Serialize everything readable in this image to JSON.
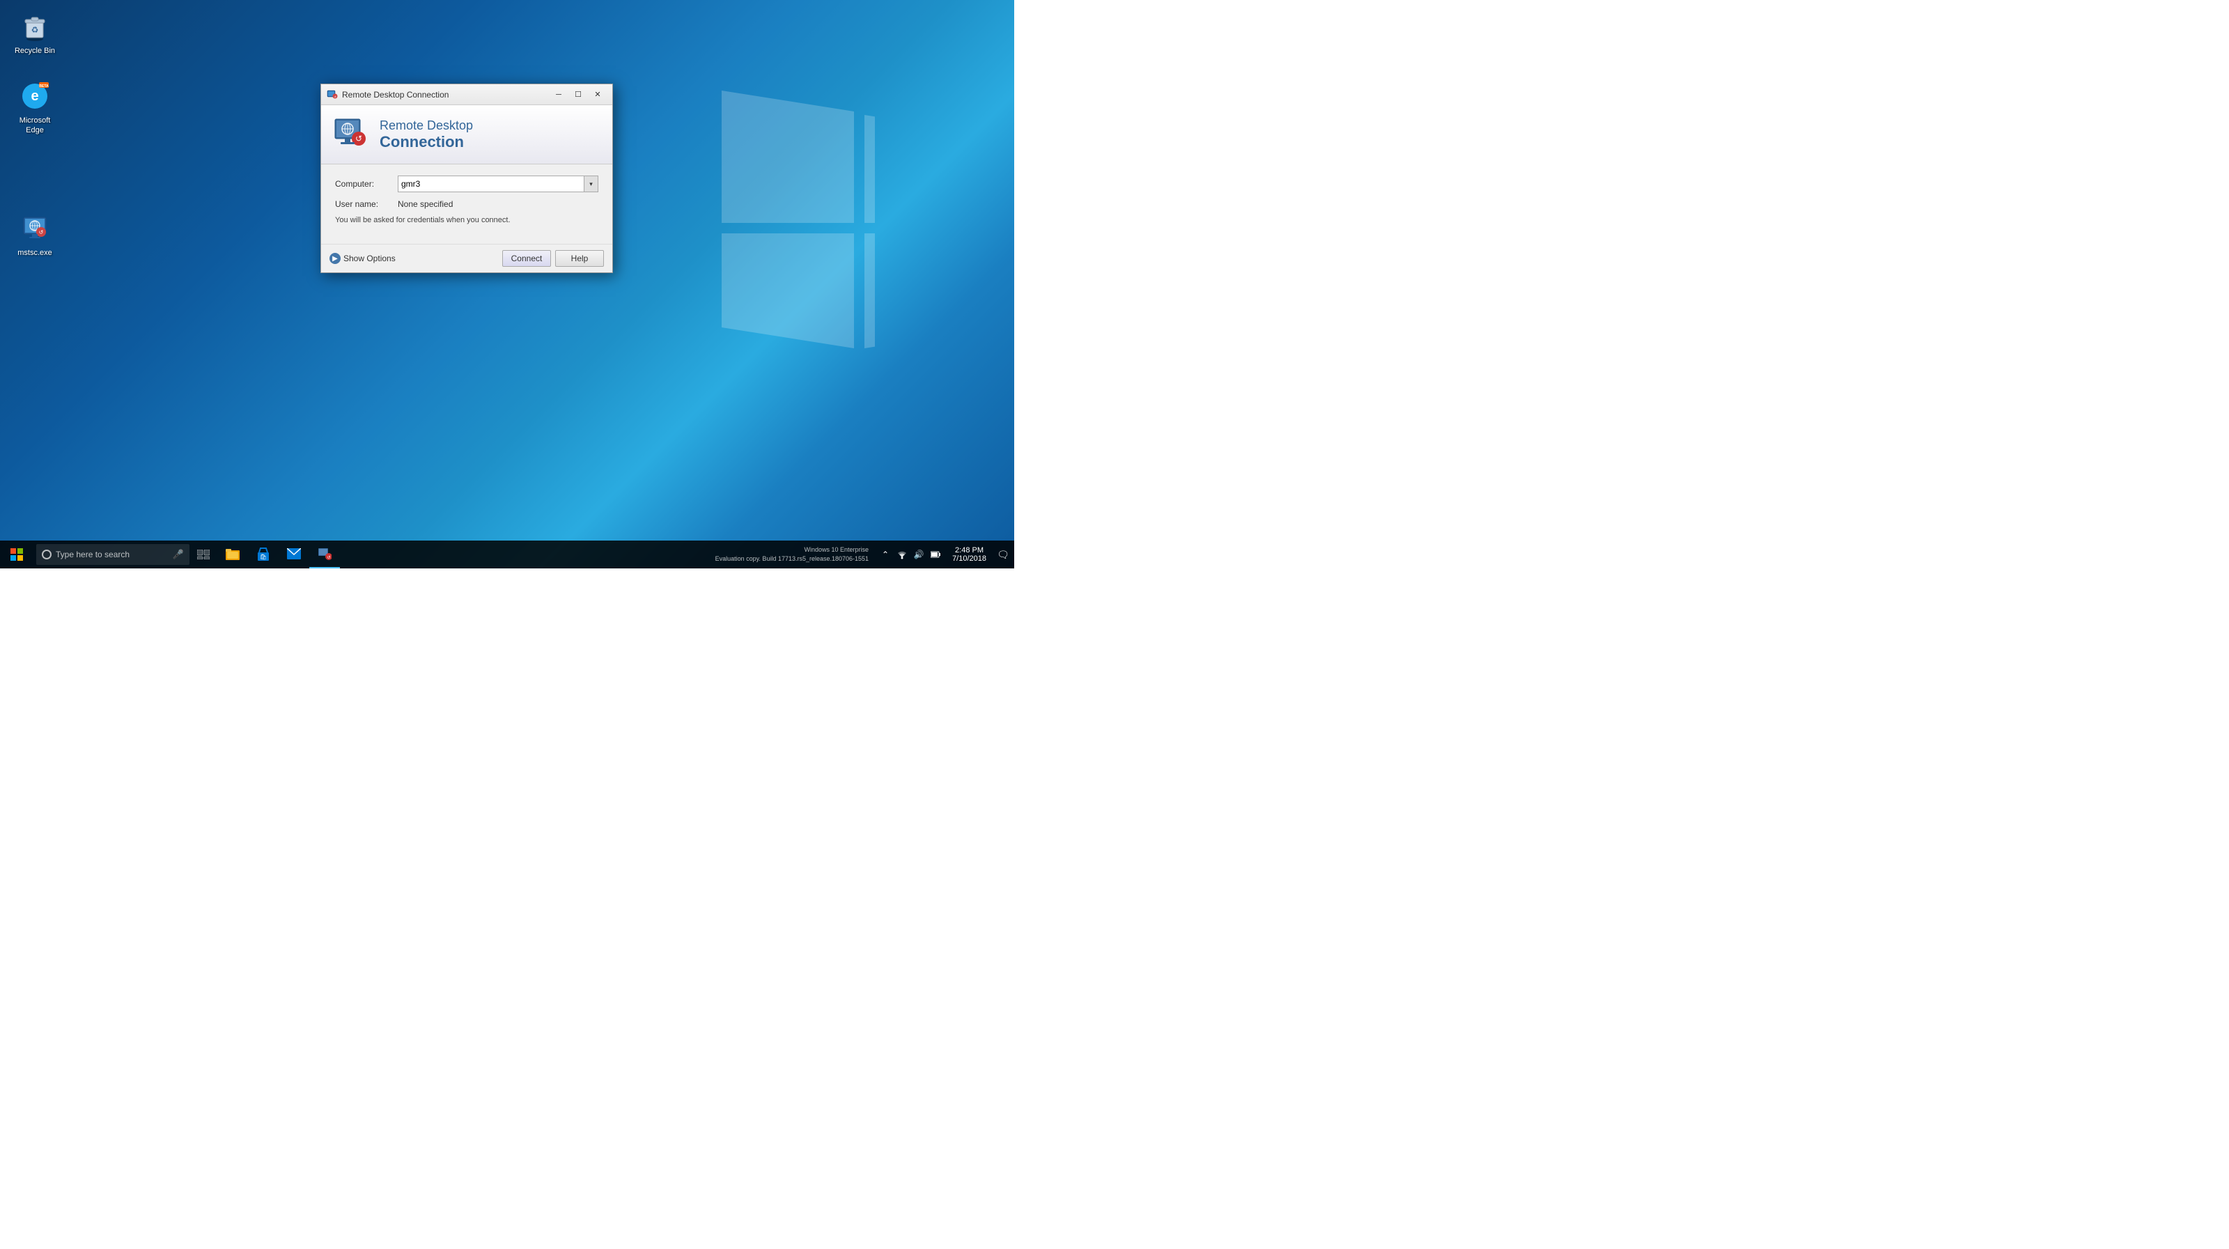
{
  "desktop": {
    "background": "Windows 10 blue gradient"
  },
  "icons": {
    "recycle_bin": {
      "label": "Recycle Bin",
      "position": "top-left"
    },
    "edge": {
      "label": "Microsoft Edge",
      "position": "left"
    },
    "mstsc": {
      "label": "mstsc.exe",
      "position": "left"
    }
  },
  "dialog": {
    "title": "Remote Desktop Connection",
    "header_line1": "Remote Desktop",
    "header_line2": "Connection",
    "computer_label": "Computer:",
    "computer_value": "gmr3",
    "username_label": "User name:",
    "username_value": "None specified",
    "info_text": "You will be asked for credentials when you connect.",
    "show_options_label": "Show Options",
    "connect_button": "Connect",
    "help_button": "Help"
  },
  "taskbar": {
    "search_placeholder": "Type here to search",
    "start_label": "Start",
    "clock_time": "2:48 PM",
    "clock_date": "7/10/2018",
    "eval_line1": "Windows 10 Enterprise",
    "eval_line2": "Evaluation copy. Build 17713.rs5_release.180706-1551"
  }
}
